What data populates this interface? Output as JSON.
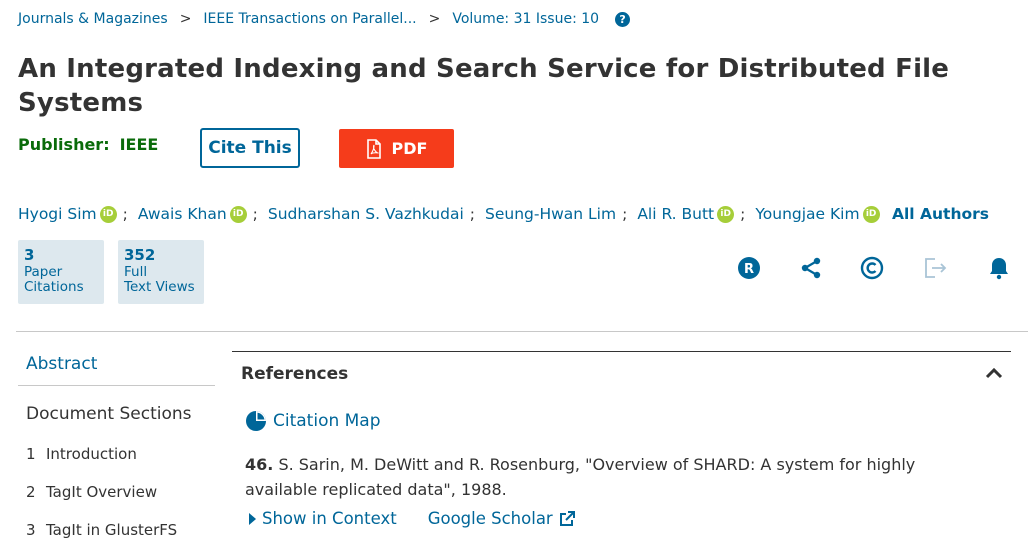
{
  "breadcrumb": {
    "items": [
      "Journals & Magazines",
      "IEEE Transactions on Parallel...",
      "Volume: 31 Issue: 10"
    ],
    "separator": ">"
  },
  "article": {
    "title": "An Integrated Indexing and Search Service for Distributed File Systems",
    "publisher_label": "Publisher:",
    "publisher_value": "IEEE",
    "cite_label": "Cite This",
    "pdf_label": "PDF"
  },
  "authors": {
    "list": [
      {
        "name": "Hyogi Sim",
        "orcid": true
      },
      {
        "name": "Awais Khan",
        "orcid": true
      },
      {
        "name": "Sudharshan S. Vazhkudai",
        "orcid": false
      },
      {
        "name": "Seung-Hwan Lim",
        "orcid": false
      },
      {
        "name": "Ali R. Butt",
        "orcid": true
      },
      {
        "name": "Youngjae Kim",
        "orcid": true
      }
    ],
    "separator": ";",
    "all_authors_label": "All Authors"
  },
  "metrics": [
    {
      "value": "3",
      "line1": "Paper",
      "line2": "Citations"
    },
    {
      "value": "352",
      "line1": "Full",
      "line2": "Text Views"
    }
  ],
  "tools": [
    "rights-icon",
    "share-icon",
    "copyright-icon",
    "export-icon",
    "alert-bell-icon"
  ],
  "nav": {
    "abstract": "Abstract",
    "document_sections": "Document Sections",
    "sections": [
      {
        "num": "1",
        "label": "Introduction"
      },
      {
        "num": "2",
        "label": "TagIt Overview"
      },
      {
        "num": "3",
        "label": "TagIt in GlusterFS"
      }
    ]
  },
  "references": {
    "heading": "References",
    "citation_map": "Citation Map",
    "entry": {
      "number": "46.",
      "text": "S. Sarin, M. DeWitt and R. Rosenburg, \"Overview of SHARD: A system for highly available replicated data\", 1988.",
      "show_in_context": "Show in Context",
      "google_scholar": "Google Scholar"
    }
  },
  "colors": {
    "link": "#006699",
    "publisher": "#0a6b0a",
    "pdf_button": "#f53c1b",
    "metric_bg": "#dde8ee",
    "orcid": "#a6ce39"
  }
}
